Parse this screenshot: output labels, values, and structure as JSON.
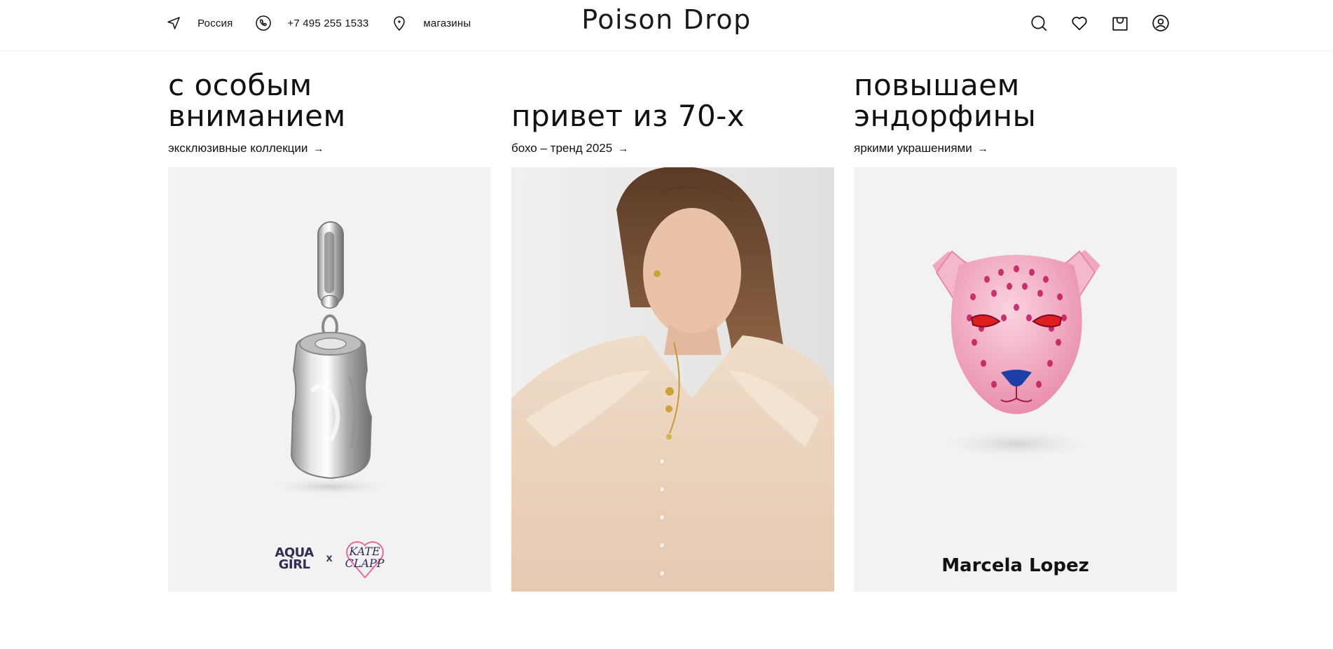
{
  "header": {
    "region": "Россия",
    "phone": "+7 495 255 1533",
    "stores": "магазины",
    "logo": "Poison Drop"
  },
  "icons": {
    "location": "navigation-arrow-icon",
    "phone": "phone-icon",
    "stores": "map-pin-icon",
    "search": "search-icon",
    "wishlist": "heart-icon",
    "cart": "shopping-bag-icon",
    "account": "user-icon"
  },
  "cards": [
    {
      "title_line1": "с особым",
      "title_line2": "вниманием",
      "link": "эксклюзивные коллекции",
      "brand_left_line1": "AQUA",
      "brand_left_line2": "GIRL",
      "brand_sep": "x",
      "brand_right_line1": "KATE",
      "brand_right_line2": "CLAPP"
    },
    {
      "title_line1": "привет из 70-х",
      "link": "бохо – тренд 2025"
    },
    {
      "title_line1": "повышаем",
      "title_line2": "эндорфины",
      "link": "яркими украшениями",
      "brand": "Marcela Lopez"
    }
  ],
  "colors": {
    "text": "#111111",
    "card_bg": "#f2f2f2",
    "brand_purple": "#342c52",
    "heart_pink": "#e26aa0"
  }
}
